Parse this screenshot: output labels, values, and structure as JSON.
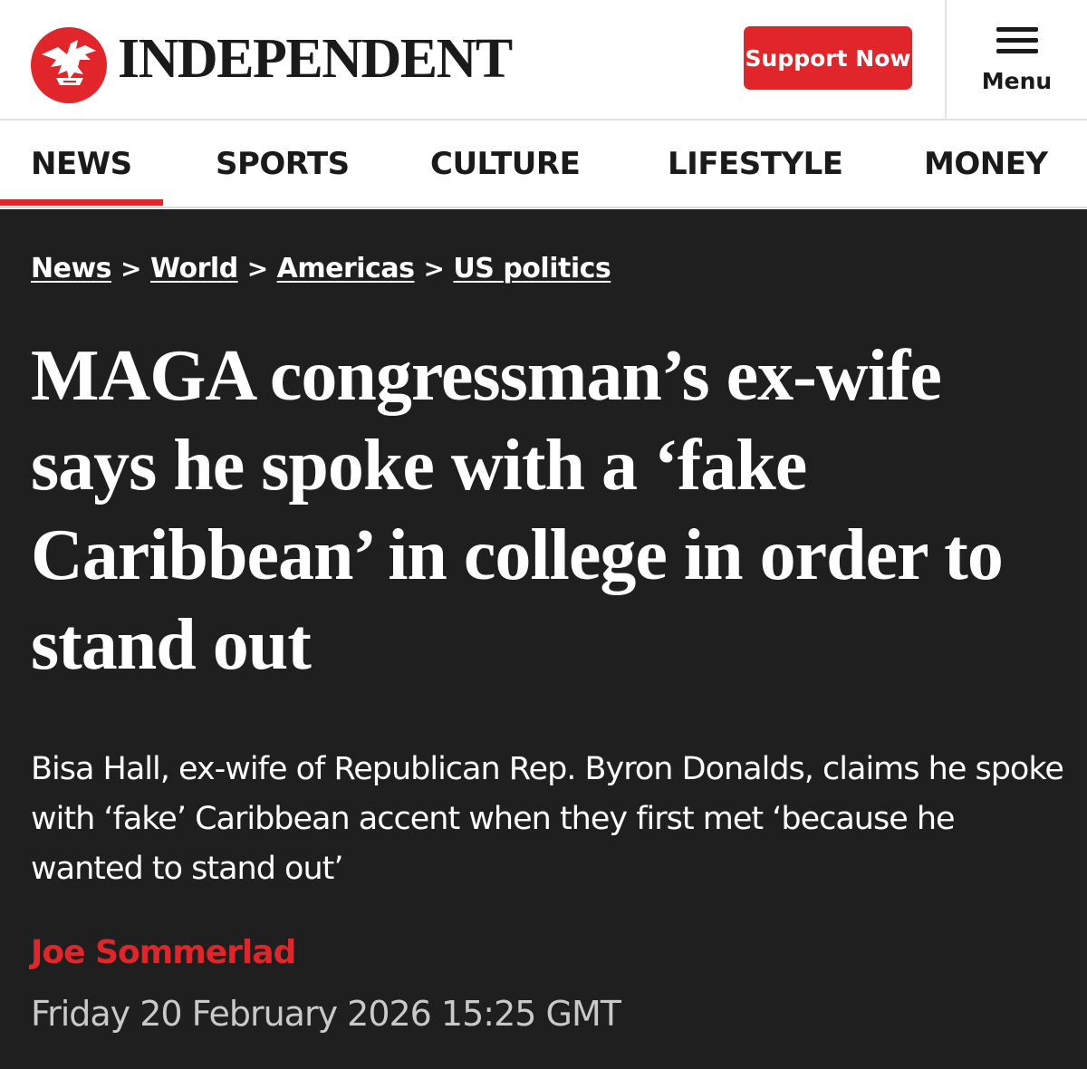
{
  "header": {
    "logo_text": "INDEPENDENT",
    "support_label": "Support Now",
    "menu_label": "Menu"
  },
  "nav": {
    "items": [
      "NEWS",
      "SPORTS",
      "CULTURE",
      "LIFESTYLE",
      "MONEY"
    ],
    "active": "NEWS"
  },
  "breadcrumb": [
    "News",
    "World",
    "Americas",
    "US politics"
  ],
  "breadcrumb_separator": ">",
  "article": {
    "headline": "MAGA congressman’s ex-wife says he spoke with a ‘fake Caribbean’ in college in order to stand out",
    "standfirst": "Bisa Hall, ex-wife of Republican Rep. Byron Donalds, claims he spoke with ‘fake’ Caribbean accent when they first met ‘because he wanted to stand out’",
    "author": "Joe Sommerlad",
    "date": "Friday 20 February 2026 15:25 GMT"
  },
  "colors": {
    "brand_red": "#e0262b",
    "article_bg": "#1f1f1f",
    "text_dark": "#1a1a1a"
  },
  "icons": [
    "eagle-logo-icon",
    "hamburger-menu-icon"
  ]
}
